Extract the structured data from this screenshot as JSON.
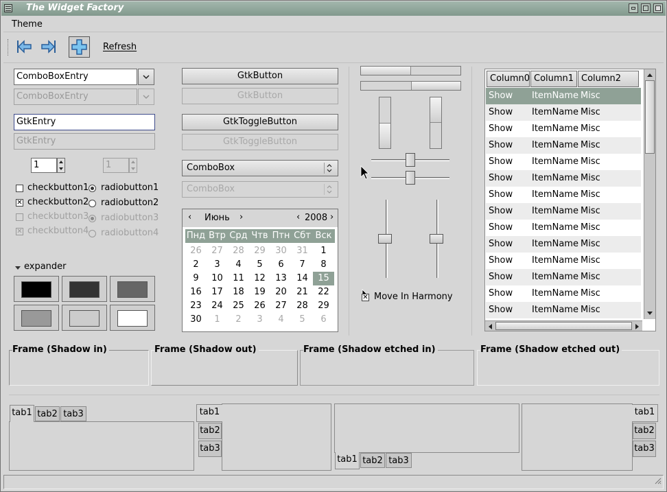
{
  "window": {
    "title": "The Widget Factory"
  },
  "menu": {
    "theme": "Theme"
  },
  "toolbar": {
    "refresh": "Refresh"
  },
  "col1": {
    "combo_entry": "ComboBoxEntry",
    "combo_entry_disabled": "ComboBoxEntry",
    "entry": "GtkEntry",
    "entry_disabled": "GtkEntry",
    "spin": "1",
    "spin_disabled": "1",
    "checks": [
      {
        "label": "checkbutton1",
        "checked": false
      },
      {
        "label": "checkbutton2",
        "checked": true
      },
      {
        "label": "checkbutton3",
        "checked": false
      },
      {
        "label": "checkbutton4",
        "checked": true
      }
    ],
    "radios": [
      {
        "label": "radiobutton1",
        "checked": true
      },
      {
        "label": "radiobutton2",
        "checked": false
      },
      {
        "label": "radiobutton3",
        "checked": true
      },
      {
        "label": "radiobutton4",
        "checked": false
      }
    ],
    "expander": "expander",
    "swatches": [
      "#000000",
      "#333333",
      "#666666",
      "#999999",
      "#cccccc",
      "#ffffff"
    ]
  },
  "col2": {
    "button": "GtkButton",
    "button_disabled": "GtkButton",
    "toggle": "GtkToggleButton",
    "toggle_disabled": "GtkToggleButton",
    "combobox": "ComboBox",
    "combobox_disabled": "ComboBox",
    "calendar": {
      "month": "Июнь",
      "year": "2008",
      "weekdays": [
        "Пнд",
        "Втр",
        "Срд",
        "Чтв",
        "Птн",
        "Сбт",
        "Вск"
      ],
      "days": [
        [
          "26",
          "27",
          "28",
          "29",
          "30",
          "31",
          "1"
        ],
        [
          "2",
          "3",
          "4",
          "5",
          "6",
          "7",
          "8"
        ],
        [
          "9",
          "10",
          "11",
          "12",
          "13",
          "14",
          "15"
        ],
        [
          "16",
          "17",
          "18",
          "19",
          "20",
          "21",
          "22"
        ],
        [
          "23",
          "24",
          "25",
          "26",
          "27",
          "28",
          "29"
        ],
        [
          "30",
          "1",
          "2",
          "3",
          "4",
          "5",
          "6"
        ]
      ],
      "selected": "15"
    }
  },
  "col3": {
    "hbar1_fraction": 0.5,
    "hbar2_fraction": 0.5,
    "vbar1_fraction": 0.5,
    "vbar2_fraction": 0.5,
    "hscale_value": 0.5,
    "vscale_value": 0.5,
    "move_in_harmony": "Move In Harmony",
    "move_checked": true
  },
  "tree": {
    "columns": [
      "Column0",
      "Column1",
      "Column2"
    ],
    "rows": [
      [
        "Show",
        "ItemName",
        "Misc"
      ],
      [
        "Show",
        "ItemName",
        "Misc"
      ],
      [
        "Show",
        "ItemName",
        "Misc"
      ],
      [
        "Show",
        "ItemName",
        "Misc"
      ],
      [
        "Show",
        "ItemName",
        "Misc"
      ],
      [
        "Show",
        "ItemName",
        "Misc"
      ],
      [
        "Show",
        "ItemName",
        "Misc"
      ],
      [
        "Show",
        "ItemName",
        "Misc"
      ],
      [
        "Show",
        "ItemName",
        "Misc"
      ],
      [
        "Show",
        "ItemName",
        "Misc"
      ],
      [
        "Show",
        "ItemName",
        "Misc"
      ],
      [
        "Show",
        "ItemName",
        "Misc"
      ],
      [
        "Show",
        "ItemName",
        "Misc"
      ],
      [
        "Show",
        "ItemName",
        "Misc"
      ]
    ]
  },
  "frames": [
    "Frame (Shadow in)",
    "Frame (Shadow out)",
    "Frame (Shadow etched in)",
    "Frame (Shadow etched out)"
  ],
  "tabs": [
    "tab1",
    "tab2",
    "tab3"
  ]
}
